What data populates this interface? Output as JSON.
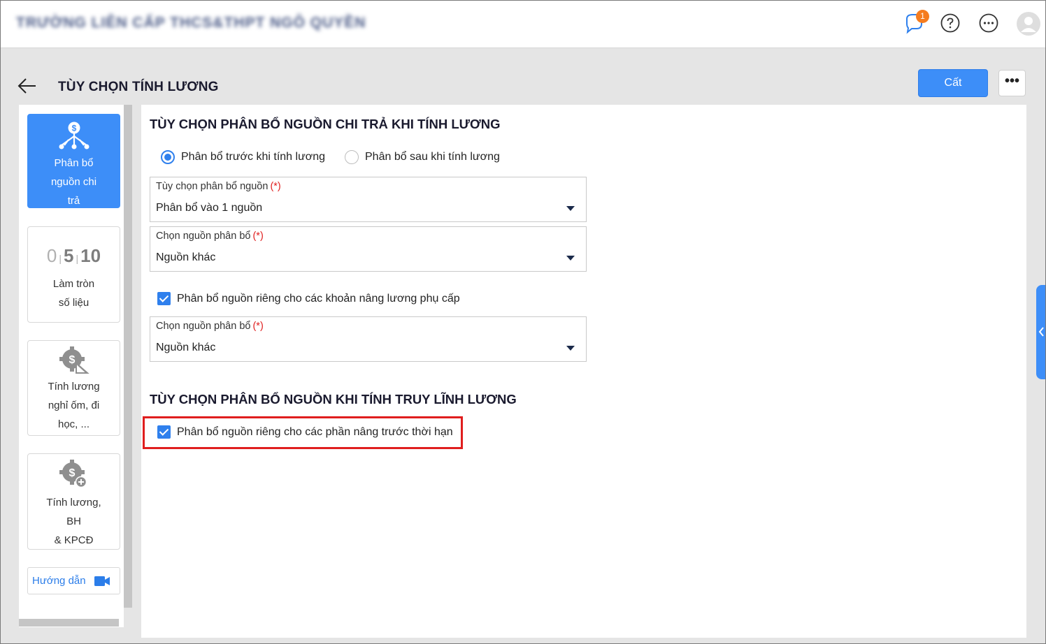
{
  "topbar": {
    "org_name": "TRƯỜNG LIÊN CẤP THCS&THPT NGÔ QUYỀN",
    "notification_count": "1",
    "icons": [
      "bell-icon",
      "help-icon",
      "more-horizontal-icon",
      "user-avatar-icon"
    ]
  },
  "header": {
    "title": "TÙY CHỌN TÍNH LƯƠNG",
    "save_label": "Cất",
    "more_label": "•••"
  },
  "sidebar": {
    "items": [
      {
        "label": "Phân bổ\nnguồn chi\ntrả",
        "icon": "fund-allocation-icon",
        "active": true
      },
      {
        "label": "Làm tròn\nsố liệu",
        "icon": "rounding-icon",
        "icon_text": "0 5 10",
        "active": false
      },
      {
        "label": "Tính lương\nnghỉ ốm, đi\nhọc, ...",
        "icon": "salary-settings-icon",
        "active": false
      },
      {
        "label": "Tính lương,\nBH\n& KPCĐ",
        "icon": "salary-insurance-icon",
        "active": false
      }
    ],
    "guide_label": "Hướng dẫn",
    "guide_icon": "video-camera-icon"
  },
  "main": {
    "section1_title": "TÙY CHỌN PHÂN BỔ NGUỒN CHI TRẢ KHI TÍNH LƯƠNG",
    "radio_before": "Phân bổ trước khi tính lương",
    "radio_after": "Phân bổ sau khi tính lương",
    "selected_radio": "before",
    "field1": {
      "label": "Tùy chọn phân bổ nguồn",
      "required": "(*)",
      "value": "Phân bổ vào 1 nguồn"
    },
    "field2": {
      "label": "Chọn nguồn phân bổ",
      "required": "(*)",
      "value": "Nguồn khác"
    },
    "checkbox1": "Phân bổ nguồn riêng cho các khoản nâng lương phụ cấp",
    "field3": {
      "label": "Chọn nguồn phân bổ",
      "required": "(*)",
      "value": "Nguồn khác"
    },
    "section2_title": "TÙY CHỌN PHÂN BỔ NGUỒN KHI TÍNH TRUY LĨNH LƯƠNG",
    "checkbox2": "Phân bổ nguồn riêng cho các phần nâng trước thời hạn"
  },
  "colors": {
    "accent": "#3d8ef8",
    "highlight": "#e01e1e",
    "badge": "#f57c1f"
  }
}
